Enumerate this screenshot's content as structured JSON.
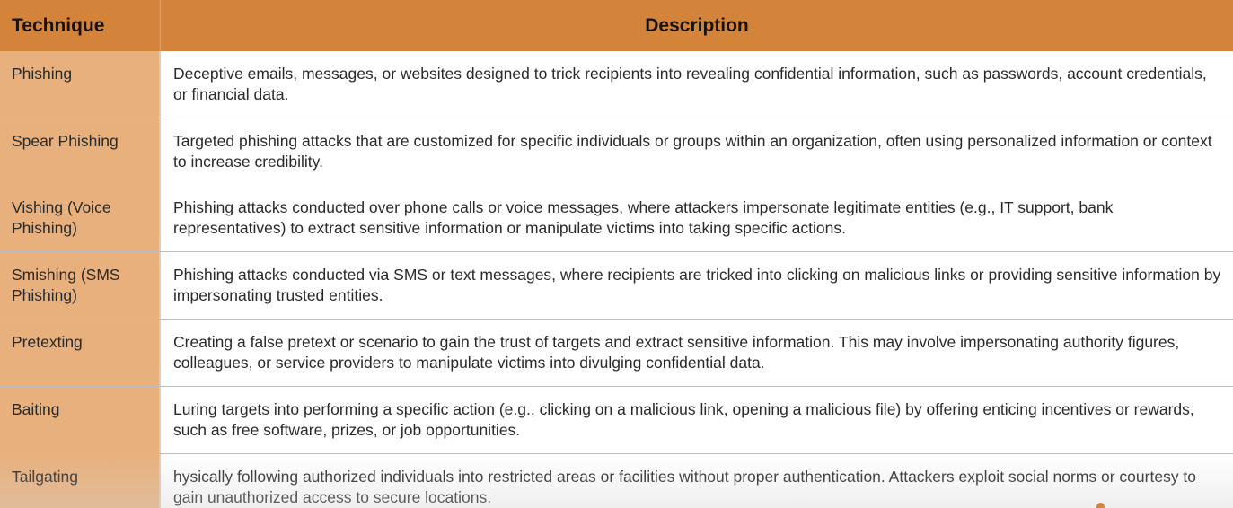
{
  "table": {
    "headers": {
      "technique": "Technique",
      "description": "Description"
    },
    "rows": [
      {
        "technique": "Phishing",
        "description": "Deceptive emails, messages, or websites designed to trick recipients into revealing confidential information, such as passwords, account credentials, or financial data."
      },
      {
        "technique": "Spear Phishing",
        "description": "Targeted phishing attacks that are customized for specific individuals or groups within an organization, often using personalized information or context to increase credibility."
      },
      {
        "technique": "Vishing (Voice Phishing)",
        "description": "Phishing attacks conducted over phone calls or voice messages, where attackers impersonate legitimate entities (e.g., IT support, bank representatives) to extract sensitive information or manipulate victims into taking specific actions."
      },
      {
        "technique": "Smishing (SMS Phishing)",
        "description": "Phishing attacks conducted via SMS or text messages, where recipients are tricked into clicking on malicious links or providing sensitive information by impersonating trusted entities."
      },
      {
        "technique": "Pretexting",
        "description": "Creating a false pretext or scenario to gain the trust of targets and extract sensitive information. This may involve impersonating authority figures, colleagues, or service providers to manipulate victims into divulging confidential data."
      },
      {
        "technique": "Baiting",
        "description": "Luring targets into performing a specific action (e.g., clicking on a malicious link, opening a malicious file) by offering enticing incentives or rewards, such as free software, prizes, or job opportunities."
      },
      {
        "technique": "Tailgating",
        "description": "hysically following authorized individuals into restricted areas or facilities without proper authentication. Attackers exploit social norms or courtesy to gain unauthorized access to secure locations."
      }
    ]
  },
  "colors": {
    "header_bg": "#d4843a",
    "technique_cell_bg": "#e8b07d",
    "description_cell_bg": "#ffffff",
    "text": "#2a2a2a"
  }
}
